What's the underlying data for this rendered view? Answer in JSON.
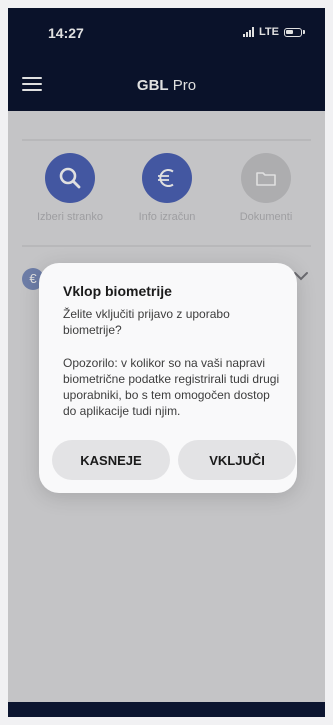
{
  "status_bar": {
    "time": "14:27",
    "network": "LTE"
  },
  "header": {
    "title_bold": "GBL",
    "title_rest": " Pro"
  },
  "actions": [
    {
      "label": "Izberi stranko",
      "icon": "search-icon",
      "color": "#4d63b8"
    },
    {
      "label": "Info izračun",
      "icon": "euro-icon",
      "color": "#4d63b8"
    },
    {
      "label": "Dokumenti",
      "icon": "folder-icon",
      "color": "#c5c5c8"
    }
  ],
  "dialog": {
    "title": "Vklop biometrije",
    "question": "Želite vključiti prijavo z uporabo biometrije?",
    "warning": "Opozorilo: v kolikor so na vaši napravi biometrične podatke registrirali tudi drugi uporabniki, bo s tem omogočen dostop do aplikacije tudi njim.",
    "later_label": "KASNEJE",
    "enable_label": "VKLJUČI"
  },
  "colors": {
    "primary_dark": "#0c1530",
    "accent": "#4d63b8"
  }
}
